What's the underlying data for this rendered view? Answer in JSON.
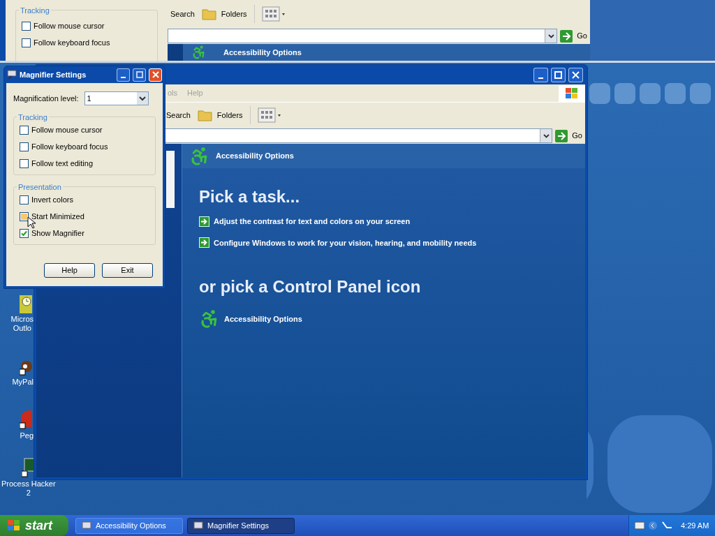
{
  "magnifier_view": {
    "group_label": "Tracking",
    "options": [
      {
        "label": "Follow mouse cursor",
        "checked": false
      },
      {
        "label": "Follow keyboard focus",
        "checked": false
      }
    ],
    "toolbar": [
      "Search",
      "Folders"
    ],
    "go": "Go",
    "header": "Accessibility Options"
  },
  "desktop_icons": [
    {
      "kind": "outlook",
      "lines": [
        "Micros",
        "Outlo"
      ]
    },
    {
      "kind": "mypal",
      "lines": [
        "MyPal"
      ]
    },
    {
      "kind": "peg",
      "lines": [
        "Peg"
      ]
    },
    {
      "kind": "hacker",
      "lines": [
        "Process Hacker",
        "2"
      ]
    }
  ],
  "explorer": {
    "menu": [
      "ols",
      "Help"
    ],
    "toolbar": [
      "Search",
      "Folders"
    ],
    "go": "Go",
    "header": "Accessibility Options",
    "task_heading": "Pick a task...",
    "tasks": [
      "Adjust the contrast for text and colors on your screen",
      "Configure Windows to work for your vision, hearing, and mobility needs"
    ],
    "icon_heading": "or pick a Control Panel icon",
    "icons": [
      "Accessibility Options"
    ]
  },
  "dialog": {
    "title": "Magnifier Settings",
    "level_label": "Magnification level:",
    "level_value": "1",
    "groups": [
      {
        "label": "Tracking",
        "options": [
          {
            "label": "Follow mouse cursor",
            "checked": false,
            "hovered": false
          },
          {
            "label": "Follow keyboard focus",
            "checked": false,
            "hovered": false
          },
          {
            "label": "Follow text editing",
            "checked": false,
            "hovered": false
          }
        ]
      },
      {
        "label": "Presentation",
        "options": [
          {
            "label": "Invert colors",
            "checked": false,
            "hovered": false
          },
          {
            "label": "Start Minimized",
            "checked": false,
            "hovered": true
          },
          {
            "label": "Show Magnifier",
            "checked": true,
            "hovered": false
          }
        ]
      }
    ],
    "buttons": [
      "Help",
      "Exit"
    ]
  },
  "taskbar": {
    "start": "start",
    "tasks": [
      {
        "label": "Accessibility Options",
        "selected": false
      },
      {
        "label": "Magnifier Settings",
        "selected": true
      }
    ],
    "clock": "4:29 AM"
  }
}
